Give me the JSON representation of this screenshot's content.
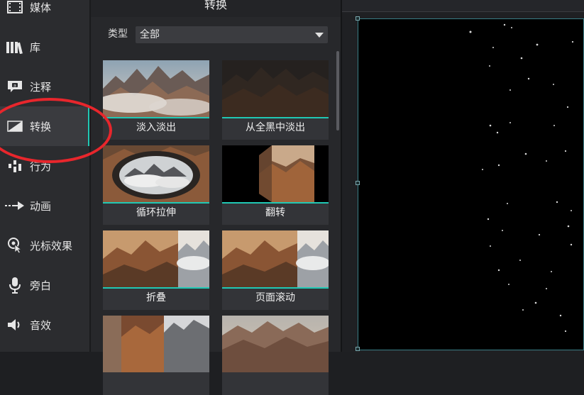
{
  "sidebar": {
    "items": [
      {
        "label": "媒体",
        "icon": "film-strip-icon"
      },
      {
        "label": "库",
        "icon": "library-books-icon"
      },
      {
        "label": "注释",
        "icon": "annotation-bubble-icon"
      },
      {
        "label": "转换",
        "icon": "transition-icon",
        "active": true
      },
      {
        "label": "行为",
        "icon": "behavior-bars-icon"
      },
      {
        "label": "动画",
        "icon": "animation-arrow-icon"
      },
      {
        "label": "光标效果",
        "icon": "cursor-effect-icon"
      },
      {
        "label": "旁白",
        "icon": "microphone-icon"
      },
      {
        "label": "音效",
        "icon": "speaker-icon"
      }
    ]
  },
  "panel": {
    "title": "转换",
    "filter": {
      "label": "类型",
      "selected": "全部"
    },
    "transitions": [
      {
        "label": "淡入淡出"
      },
      {
        "label": "从全黑中淡出"
      },
      {
        "label": "循环拉伸"
      },
      {
        "label": "翻转"
      },
      {
        "label": "折叠"
      },
      {
        "label": "页面滚动"
      },
      {
        "label": ""
      },
      {
        "label": ""
      }
    ]
  },
  "colors": {
    "accent": "#20c8b4",
    "highlight_circle": "#e8262c"
  }
}
